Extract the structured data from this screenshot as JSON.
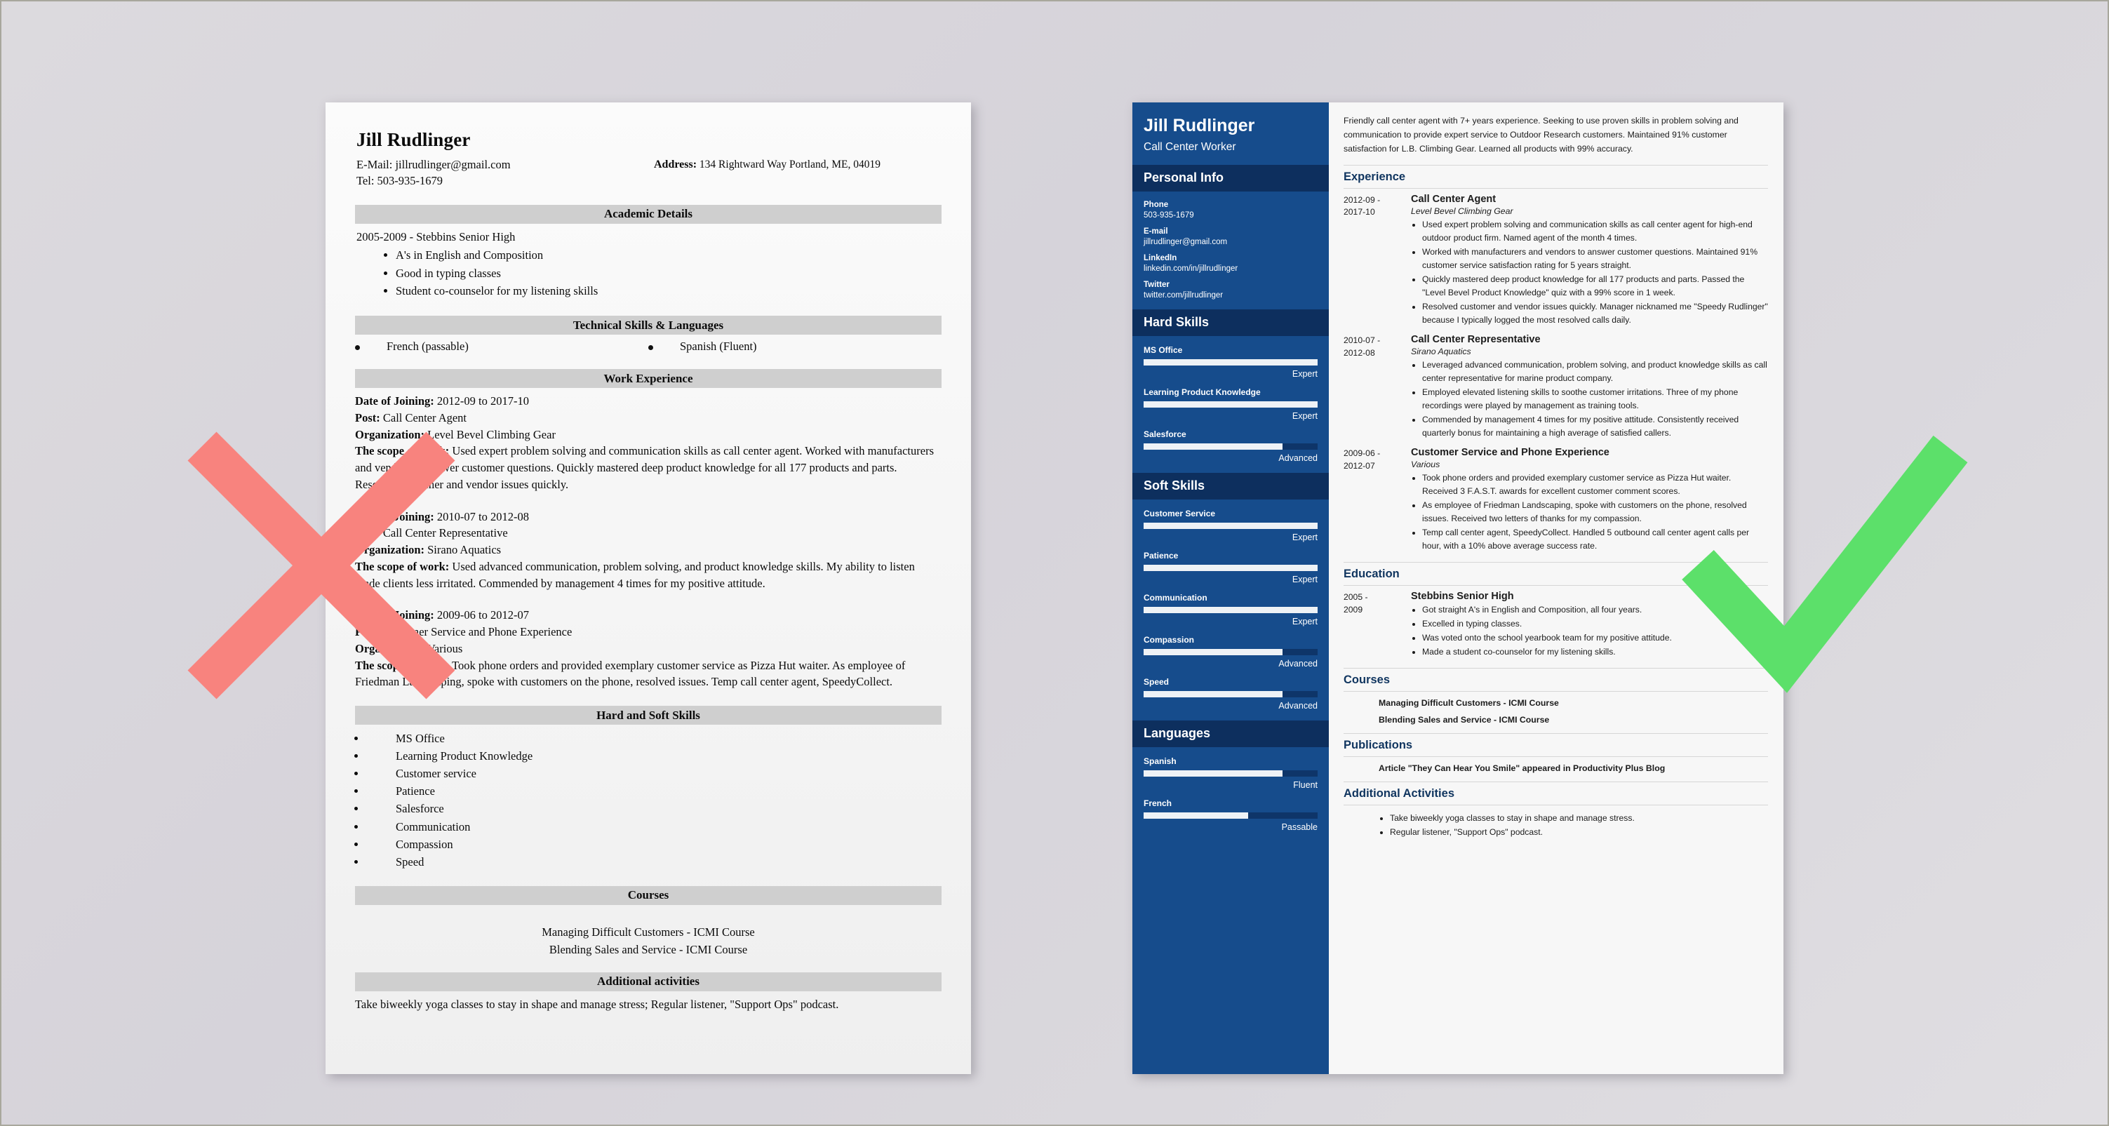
{
  "overlay": {
    "bad_mark": "red-x-mark",
    "good_mark": "green-check-mark",
    "bad_color": "#f8837e",
    "good_color": "#5ce06a"
  },
  "bad_resume": {
    "name": "Jill Rudlinger",
    "email_line": "E-Mail: jillrudlinger@gmail.com",
    "tel_line": "Tel: 503-935-1679",
    "address_label": "Address:",
    "address_value": "134 Rightward Way Portland, ME, 04019",
    "sections": {
      "academic": "Academic Details",
      "technical": "Technical Skills & Languages",
      "work": "Work Experience",
      "skills": "Hard and Soft Skills",
      "courses": "Courses",
      "additional": "Additional activities"
    },
    "academic": {
      "school_line": "2005-2009 - Stebbins Senior High",
      "bullets": [
        "A's in English and Composition",
        "Good in typing classes",
        "Student co-counselor for my listening skills"
      ]
    },
    "technical": {
      "left": "French (passable)",
      "right": "Spanish (Fluent)"
    },
    "jobs": [
      {
        "date_label": "Date of Joining:",
        "date_value": "2012-09 to 2017-10",
        "post_label": "Post:",
        "post_value": "Call Center Agent",
        "org_label": "Organization:",
        "org_value": "Level Bevel Climbing Gear",
        "scope_label": "The scope of work:",
        "scope_value": "Used expert problem solving and communication skills as call center agent. Worked with manufacturers and vendors to answer customer questions. Quickly mastered deep product knowledge for all 177 products and parts. Resolved customer and vendor issues quickly."
      },
      {
        "date_label": "Date of Joining:",
        "date_value": "2010-07 to 2012-08",
        "post_label": "Post:",
        "post_value": "Call Center Representative",
        "org_label": "Organization:",
        "org_value": "Sirano Aquatics",
        "scope_label": "The scope of work:",
        "scope_value": "Used advanced communication, problem solving, and product knowledge skills. My ability to listen made clients less irritated. Commended by management 4 times for my positive attitude."
      },
      {
        "date_label": "Date of Joining:",
        "date_value": "2009-06 to 2012-07",
        "post_label": "Post:",
        "post_value": "Customer Service and Phone Experience",
        "org_label": "Organization:",
        "org_value": "Various",
        "scope_label": "The scope of work:",
        "scope_value": "Took phone orders and provided exemplary customer service as Pizza Hut waiter. As employee of Friedman Landscaping, spoke with customers on the phone, resolved issues. Temp call center agent, SpeedyCollect."
      }
    ],
    "skills": [
      "MS Office",
      "Learning Product Knowledge",
      "Customer service",
      "Patience",
      "Salesforce",
      "Communication",
      "Compassion",
      "Speed"
    ],
    "courses": [
      "Managing Difficult Customers - ICMI Course",
      "Blending Sales and Service - ICMI Course"
    ],
    "additional": "Take biweekly yoga classes to stay in shape and manage stress; Regular listener, \"Support Ops\" podcast."
  },
  "good_resume": {
    "sidebar": {
      "name": "Jill Rudlinger",
      "role": "Call Center Worker",
      "personal_info_title": "Personal Info",
      "personal_info": [
        {
          "label": "Phone",
          "value": "503-935-1679"
        },
        {
          "label": "E-mail",
          "value": "jillrudlinger@gmail.com"
        },
        {
          "label": "LinkedIn",
          "value": "linkedin.com/in/jillrudlinger"
        },
        {
          "label": "Twitter",
          "value": "twitter.com/jillrudlinger"
        }
      ],
      "hard_skills_title": "Hard Skills",
      "hard_skills": [
        {
          "name": "MS Office",
          "level": "Expert",
          "percent": 100
        },
        {
          "name": "Learning Product Knowledge",
          "level": "Expert",
          "percent": 100
        },
        {
          "name": "Salesforce",
          "level": "Advanced",
          "percent": 80
        }
      ],
      "soft_skills_title": "Soft Skills",
      "soft_skills": [
        {
          "name": "Customer Service",
          "level": "Expert",
          "percent": 100
        },
        {
          "name": "Patience",
          "level": "Expert",
          "percent": 100
        },
        {
          "name": "Communication",
          "level": "Expert",
          "percent": 100
        },
        {
          "name": "Compassion",
          "level": "Advanced",
          "percent": 80
        },
        {
          "name": "Speed",
          "level": "Advanced",
          "percent": 80
        }
      ],
      "languages_title": "Languages",
      "languages": [
        {
          "name": "Spanish",
          "level": "Fluent",
          "percent": 80
        },
        {
          "name": "French",
          "level": "Passable",
          "percent": 60
        }
      ]
    },
    "summary": "Friendly call center agent with 7+ years experience. Seeking to use proven skills in problem solving and communication to provide expert service to Outdoor Research customers. Maintained 91% customer satisfaction for L.B. Climbing Gear. Learned all products with 99% accuracy.",
    "sections": {
      "experience": "Experience",
      "education": "Education",
      "courses": "Courses",
      "publications": "Publications",
      "additional": "Additional Activities"
    },
    "experience": [
      {
        "date": "2012-09 -\n2017-10",
        "title": "Call Center Agent",
        "org": "Level Bevel Climbing Gear",
        "bullets": [
          "Used expert problem solving and communication skills as call center agent for high-end outdoor product firm. Named agent of the month 4 times.",
          "Worked with manufacturers and vendors to answer customer questions. Maintained 91% customer service satisfaction rating for 5 years straight.",
          "Quickly mastered deep product knowledge for all 177 products and parts. Passed the \"Level Bevel Product Knowledge\" quiz with a 99% score in 1 week.",
          "Resolved customer and vendor issues quickly. Manager nicknamed me \"Speedy Rudlinger\" because I typically logged the most resolved calls daily."
        ]
      },
      {
        "date": "2010-07 -\n2012-08",
        "title": "Call Center Representative",
        "org": "Sirano Aquatics",
        "bullets": [
          "Leveraged advanced communication, problem solving, and product knowledge skills as call center representative for marine product company.",
          "Employed elevated listening skills to soothe customer irritations. Three of my phone recordings were played by management as training tools.",
          "Commended by management 4 times for my positive attitude. Consistently received quarterly bonus for maintaining a high average of satisfied callers."
        ]
      },
      {
        "date": "2009-06 -\n2012-07",
        "title": "Customer Service and Phone Experience",
        "org": "Various",
        "bullets": [
          "Took phone orders and provided exemplary customer service as Pizza Hut waiter. Received 3 F.A.S.T. awards for excellent customer comment scores.",
          "As employee of Friedman Landscaping, spoke with customers on the phone, resolved issues. Received two letters of thanks for my compassion.",
          "Temp call center agent, SpeedyCollect. Handled 5 outbound call center agent calls per hour, with a 10% above average success rate."
        ]
      }
    ],
    "education": [
      {
        "date": "2005 -\n2009",
        "title": "Stebbins Senior High",
        "bullets": [
          "Got straight A's in English and Composition, all four years.",
          "Excelled in typing classes.",
          "Was voted onto the school yearbook team for my positive attitude.",
          "Made a student co-counselor for my listening skills."
        ]
      }
    ],
    "courses": [
      "Managing Difficult Customers - ICMI Course",
      "Blending Sales and Service - ICMI Course"
    ],
    "publications": [
      "Article \"They Can Hear You Smile\" appeared in Productivity Plus Blog"
    ],
    "additional": [
      "Take biweekly yoga classes to stay in shape and manage stress.",
      "Regular listener, \"Support Ops\" podcast."
    ]
  }
}
